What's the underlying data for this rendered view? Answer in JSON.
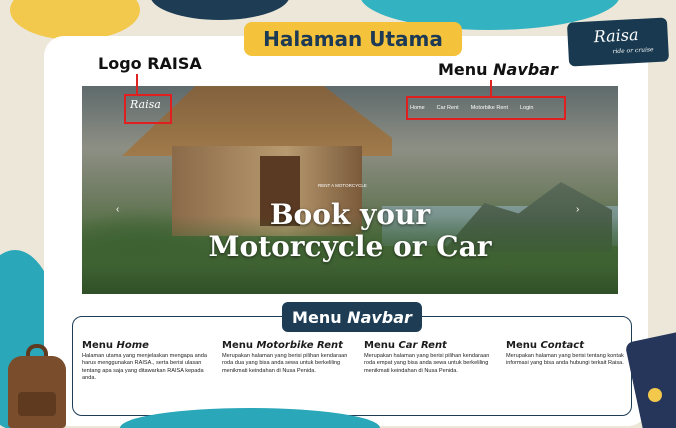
{
  "title": "Halaman Utama",
  "brand": {
    "name": "Raisa",
    "tagline": "ride or cruise"
  },
  "labels": {
    "logo": "Logo RAISA",
    "navbar_prefix": "Menu ",
    "navbar_em": "Navbar"
  },
  "site": {
    "logo_text": "Raisa",
    "nav": [
      "Home",
      "Car Rent",
      "Motorbike Rent",
      "Login"
    ],
    "hero_small": "RENT A MOTORCYCLE",
    "hero_line1": "Book your",
    "hero_line2": "Motorcycle or Car"
  },
  "panel": {
    "title_prefix": "Menu ",
    "title_em": "Navbar",
    "columns": [
      {
        "h_prefix": "Menu ",
        "h_em": "Home",
        "text": "Halaman utama yang menjelaskan mengapa anda harus menggunakan RAISA., serta berisi ulasan tentang apa saja yang ditawarkan RAISA kepada anda."
      },
      {
        "h_prefix": "Menu ",
        "h_em": "Motorbike Rent",
        "text": "Merupakan halaman yang berisi pilihan kendaraan roda dua yang bisa anda sewa untuk berkeliling menikmati keindahan di Nusa Penida."
      },
      {
        "h_prefix": "Menu ",
        "h_em": "Car Rent",
        "text": "Merupakan halaman yang berisi pilihan kendaraan roda empat yang bisa anda sewa untuk berkeliling menikmati keindahan di Nusa Penida."
      },
      {
        "h_prefix": "Menu ",
        "h_em": "Contact",
        "text": "Merupakan halaman yang berisi tentang kontak informasi yang bisa anda hubungi terkait Raisa."
      }
    ]
  },
  "colors": {
    "navy": "#1e3d55",
    "yellow": "#f4c23b",
    "teal": "#2aa7b8",
    "highlight": "#e02020"
  }
}
